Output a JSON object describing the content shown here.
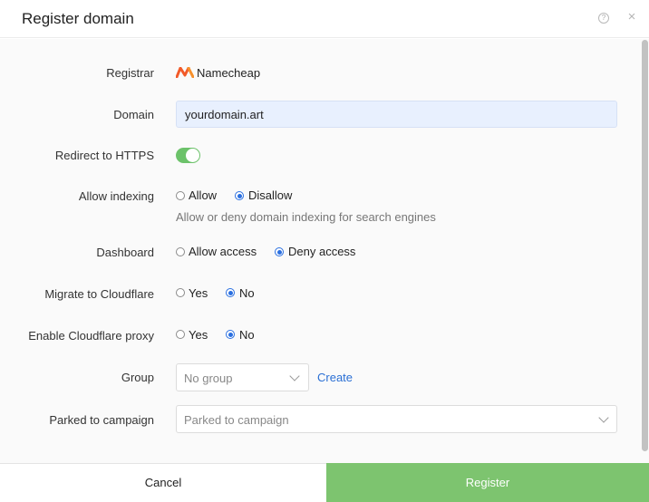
{
  "dialog": {
    "title": "Register domain",
    "help_icon": "?",
    "close_icon": "×"
  },
  "form": {
    "registrar": {
      "label": "Registrar",
      "value": "Namecheap",
      "logo_icon": "namecheap-logo"
    },
    "domain": {
      "label": "Domain",
      "value": "yourdomain.art"
    },
    "redirect_https": {
      "label": "Redirect to HTTPS",
      "enabled": true
    },
    "allow_indexing": {
      "label": "Allow indexing",
      "options": [
        "Allow",
        "Disallow"
      ],
      "selected": "Disallow",
      "hint": "Allow or deny domain indexing for search engines"
    },
    "dashboard": {
      "label": "Dashboard",
      "options": [
        "Allow access",
        "Deny access"
      ],
      "selected": "Deny access"
    },
    "migrate_cloudflare": {
      "label": "Migrate to Cloudflare",
      "options": [
        "Yes",
        "No"
      ],
      "selected": "No"
    },
    "cloudflare_proxy": {
      "label": "Enable Cloudflare proxy",
      "options": [
        "Yes",
        "No"
      ],
      "selected": "No"
    },
    "group": {
      "label": "Group",
      "placeholder": "No group",
      "create_label": "Create"
    },
    "parked_campaign": {
      "label": "Parked to campaign",
      "placeholder": "Parked to campaign"
    }
  },
  "footer": {
    "cancel_label": "Cancel",
    "register_label": "Register"
  },
  "colors": {
    "accent_green": "#7dc46f",
    "toggle_green": "#6cc26a",
    "radio_blue": "#2a6fe0",
    "link_blue": "#2a6fd4",
    "input_bg": "#e8f0fe"
  }
}
